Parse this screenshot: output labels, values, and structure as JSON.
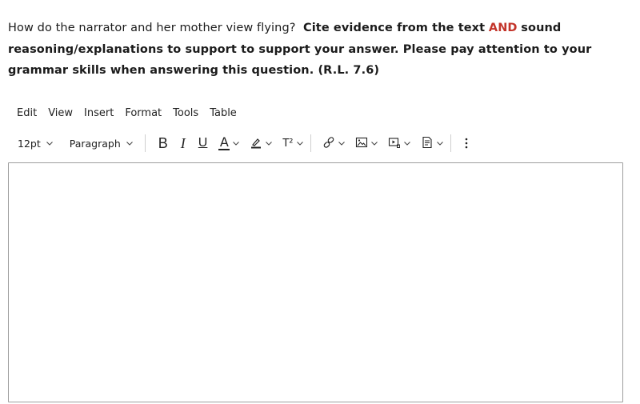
{
  "question": {
    "part1": "How do the narrator and her mother view flying?",
    "part2": "Cite evidence from the text",
    "accent_word": "AND",
    "part3": "sound reasoning/explanations to support to support your answer.  Please pay attention to your grammar skills when answering this question. (R.L. 7.6)",
    "accent_color": "#c3342a"
  },
  "menubar": {
    "items": [
      "Edit",
      "View",
      "Insert",
      "Format",
      "Tools",
      "Table"
    ]
  },
  "toolbar": {
    "font_size": "12pt",
    "block_format": "Paragraph",
    "bold_label": "B",
    "italic_label": "I",
    "underline_label": "U",
    "text_color_label": "A",
    "superscript_label": "T²",
    "icons": [
      "bold-icon",
      "italic-icon",
      "underline-icon",
      "text-color-icon",
      "highlight-icon",
      "superscript-icon",
      "link-icon",
      "image-icon",
      "media-icon",
      "document-icon",
      "more-icon"
    ]
  },
  "editor": {
    "value": ""
  }
}
